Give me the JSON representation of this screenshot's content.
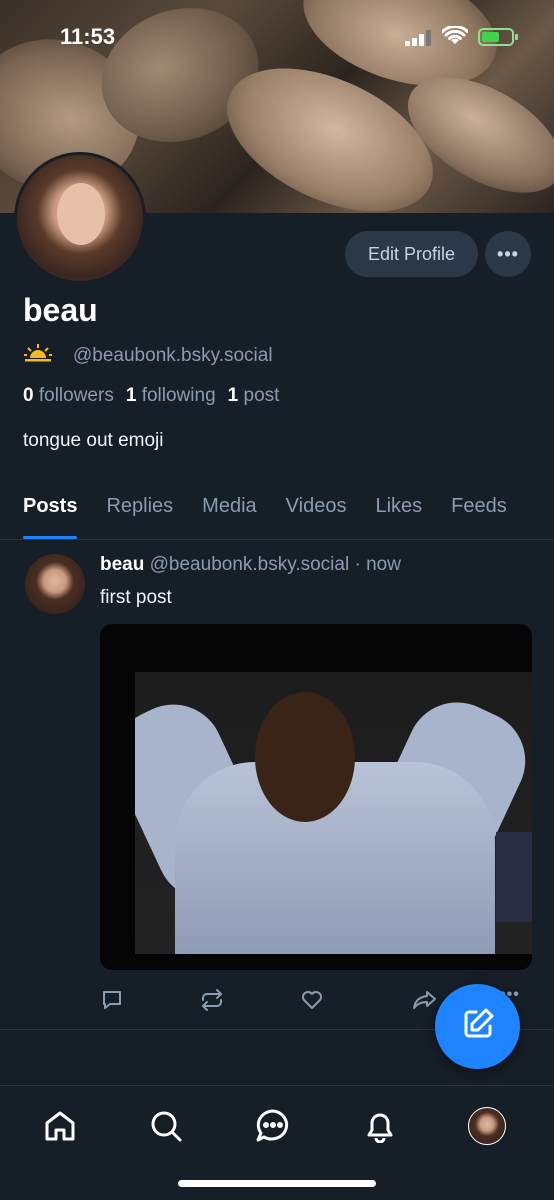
{
  "status_bar": {
    "time": "11:53"
  },
  "profile": {
    "display_name": "beau",
    "emoji": "🌅",
    "handle": "@beaubonk.bsky.social",
    "followers_count": "0",
    "followers_label": "followers",
    "following_count": "1",
    "following_label": "following",
    "posts_count": "1",
    "posts_label": "post",
    "bio": "tongue out emoji",
    "edit_label": "Edit Profile",
    "more_label": "•••"
  },
  "tabs": [
    {
      "label": "Posts",
      "active": true
    },
    {
      "label": "Replies",
      "active": false
    },
    {
      "label": "Media",
      "active": false
    },
    {
      "label": "Videos",
      "active": false
    },
    {
      "label": "Likes",
      "active": false
    },
    {
      "label": "Feeds",
      "active": false
    }
  ],
  "post": {
    "author": "beau",
    "handle": "@beaubonk.bsky.social",
    "separator": "·",
    "time": "now",
    "text": "first post",
    "more_label": "•••"
  },
  "icons": {
    "reply": "reply-icon",
    "repost": "repost-icon",
    "like": "heart-icon",
    "share": "share-icon",
    "compose": "compose-icon",
    "home": "home-icon",
    "search": "search-icon",
    "chat": "chat-icon",
    "notifications": "bell-icon"
  },
  "colors": {
    "accent": "#1e83ff",
    "background": "#161e27",
    "muted": "#8b9bb0"
  }
}
